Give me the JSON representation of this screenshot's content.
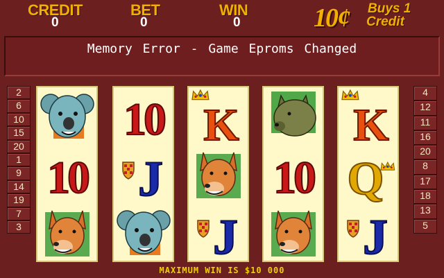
{
  "meters": {
    "credit_label": "CREDIT",
    "credit_value": "0",
    "bet_label": "BET",
    "bet_value": "0",
    "win_label": "WIN",
    "win_value": "0"
  },
  "denomination": {
    "amount": "10¢",
    "text_line1": "Buys 1",
    "text_line2": "Credit"
  },
  "message": "Memory Error - Game Eproms Changed",
  "left_lines": [
    "2",
    "6",
    "10",
    "15",
    "20",
    "1",
    "9",
    "14",
    "19",
    "7",
    "3"
  ],
  "right_lines": [
    "4",
    "12",
    "11",
    "16",
    "20",
    "8",
    "17",
    "18",
    "13",
    "5"
  ],
  "reels": [
    [
      "koala",
      "ten",
      "dingo"
    ],
    [
      "ten",
      "jack",
      "koala"
    ],
    [
      "king",
      "dingo",
      "jack"
    ],
    [
      "wombat",
      "ten",
      "dingo"
    ],
    [
      "king",
      "queen",
      "jack"
    ]
  ],
  "symbol_text": {
    "ten": "10",
    "jack": "J",
    "queen": "Q",
    "king": "K"
  },
  "footer": "MAXIMUM WIN IS $10 000",
  "colors": {
    "background": "#6b1f1f",
    "gold": "#f0b000",
    "reel_bg": "#fff8c8",
    "ten_red": "#c81818",
    "jack_blue": "#1a2aa8",
    "queen_gold": "#e0a800"
  }
}
